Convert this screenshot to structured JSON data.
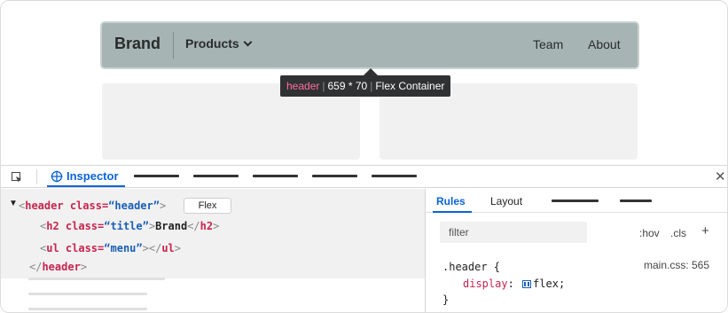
{
  "preview": {
    "brand": "Brand",
    "products": "Products",
    "nav_team": "Team",
    "nav_about": "About",
    "tooltip": {
      "tag": "header",
      "size": "659 * 70",
      "kind": "Flex Container"
    }
  },
  "devtools": {
    "inspector_label": "Inspector",
    "markup": {
      "line1": {
        "open": "<",
        "tag": "header",
        "attr": " class=",
        "val": "“header”",
        "close": ">",
        "badge": "Flex"
      },
      "line2": {
        "open": "<",
        "tag": "h2",
        "attr": " class=",
        "val": "“title”",
        "close": ">",
        "text": "Brand",
        "end_open": "</",
        "end_tag": "h2",
        "end_close": ">"
      },
      "line3": {
        "open": "<",
        "tag": "ul",
        "attr": " class=",
        "val": "“menu”",
        "close": "></",
        "end_tag": "ul",
        "end_close": ">"
      },
      "line4": {
        "open": "</",
        "tag": "header",
        "close": ">"
      }
    },
    "rules_tab": "Rules",
    "layout_tab": "Layout",
    "filter_placeholder": "filter",
    "hov": ":hov",
    "cls": ".cls",
    "add": "+",
    "rule": {
      "selector": ".header {",
      "source": "main.css: 565",
      "property": "display",
      "colon": ": ",
      "value": "flex",
      "semi": ";",
      "end": "}"
    }
  },
  "colors": {
    "accent": "#0a64d8",
    "tag": "#c7254e",
    "attr_value": "#1a5fb4",
    "navbar": "#a6b5b4",
    "tooltip_bg": "#2f3133"
  }
}
